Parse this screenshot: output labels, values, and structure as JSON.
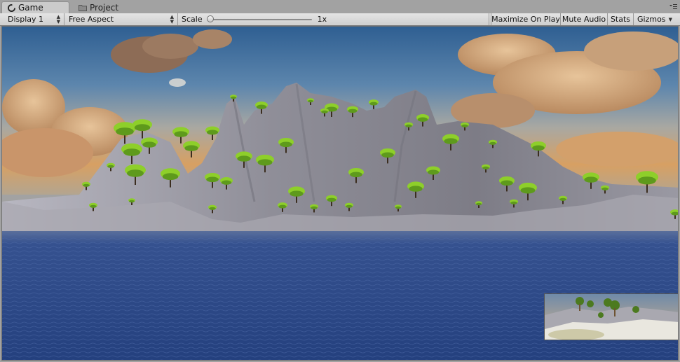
{
  "tabs": {
    "game_label": "Game",
    "project_label": "Project"
  },
  "toolbar": {
    "display": "Display 1",
    "aspect": "Free Aspect",
    "scale_label": "Scale",
    "scale_value": "1x",
    "scale_fraction": 0.0,
    "maximize_on_play": "Maximize On Play",
    "mute_audio": "Mute Audio",
    "stats": "Stats",
    "gizmos": "Gizmos"
  },
  "icons": {
    "game_tab": "unity-logo-icon",
    "project_tab": "folder-icon",
    "tab_menu": "menu-icon",
    "dropdown": "up-down-arrows-icon",
    "gizmos_dropdown": "chevron-down-icon"
  },
  "colors": {
    "sky_top": "#3d6e9e",
    "sky_horizon": "#d9a05e",
    "cloud": "#c99a6c",
    "mountain": "#8e8c95",
    "tree_foliage": "#8ecf2a",
    "water": "#2f4f8c"
  }
}
